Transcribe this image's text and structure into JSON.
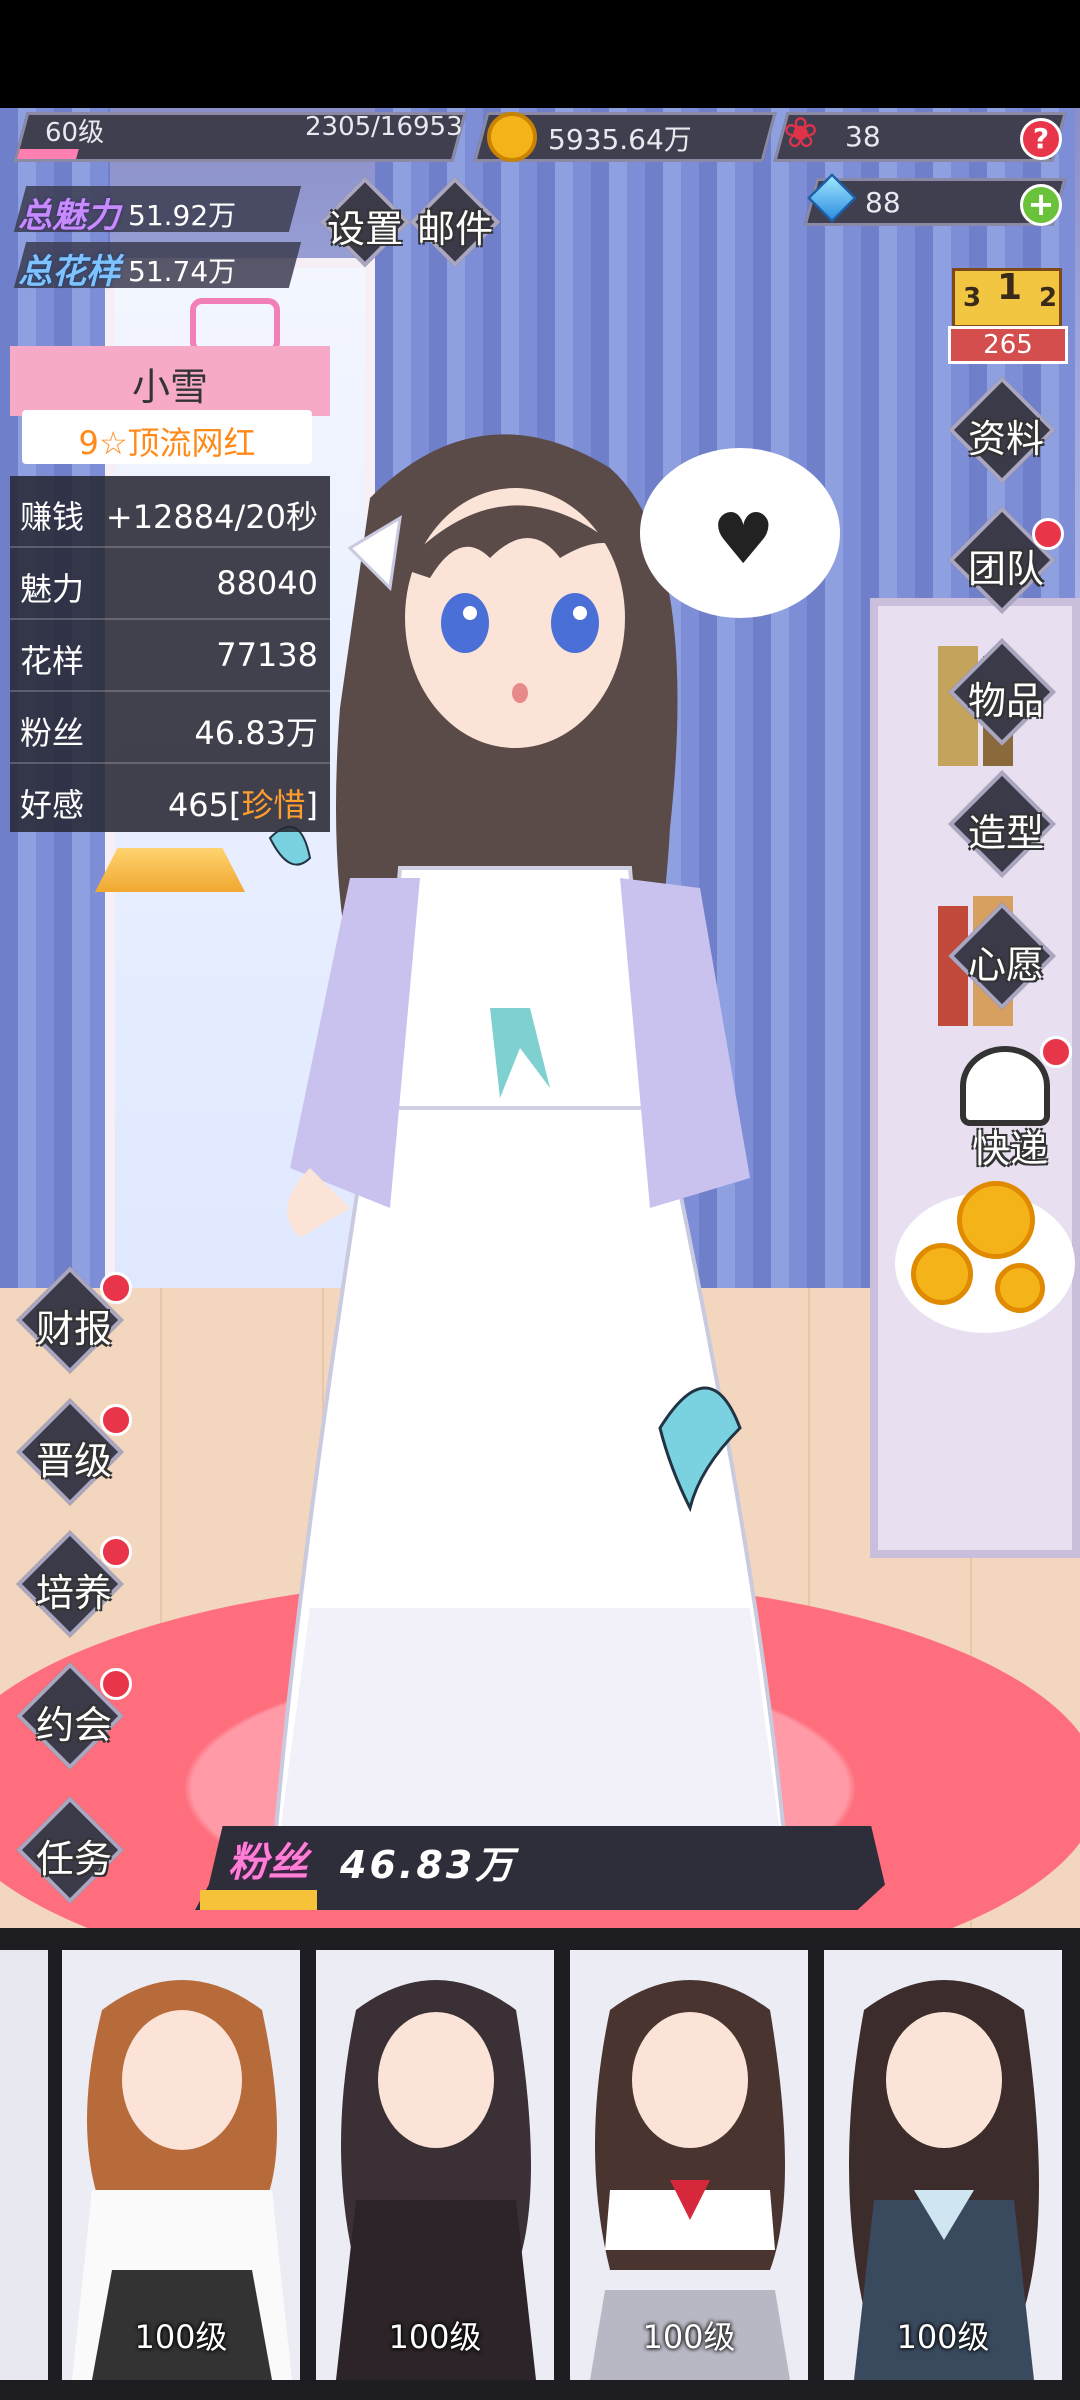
{
  "top": {
    "level": "60级",
    "exp": "2305/16953",
    "exp_fraction": 0.136,
    "coins": "5935.64万",
    "roses": "38",
    "gems": "88",
    "help": "?",
    "add": "+"
  },
  "totals": {
    "charm_label": "总魅力",
    "charm_value": "51.92万",
    "pattern_label": "总花样",
    "pattern_value": "51.74万"
  },
  "menu": {
    "settings": "设置",
    "mail": "邮件"
  },
  "rank": {
    "podium": [
      "3",
      "1",
      "2"
    ],
    "value": "265"
  },
  "character": {
    "name": "小雪",
    "title": "9☆顶流网红",
    "stats": [
      {
        "label": "赚钱",
        "value": "+12884/20秒"
      },
      {
        "label": "魅力",
        "value": "88040"
      },
      {
        "label": "花样",
        "value": "77138"
      },
      {
        "label": "粉丝",
        "value": "46.83万"
      },
      {
        "label": "好感",
        "value": "465[",
        "tag": "珍惜",
        "close": "]"
      }
    ]
  },
  "right_buttons": [
    "资料",
    "团队",
    "物品",
    "造型",
    "心愿",
    "快递"
  ],
  "left_buttons": [
    "财报",
    "晋级",
    "培养",
    "约会",
    "任务"
  ],
  "fans": {
    "label": "粉丝",
    "value": "46.83万",
    "fraction": 0.17
  },
  "cards": [
    "100级",
    "100级",
    "100级",
    "100级"
  ],
  "colors": {
    "accent_pink": "#ff6fa0",
    "reddot": "#e8354a",
    "gold": "#f5b31a",
    "title_orange": "#ff8a1a"
  }
}
